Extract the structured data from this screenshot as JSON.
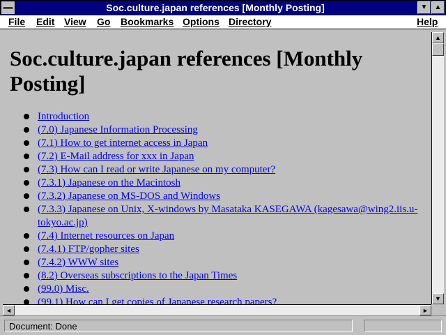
{
  "window": {
    "title": "Soc.culture.japan references [Monthly Posting]",
    "min_glyph": "▼",
    "max_glyph": "▲"
  },
  "menu": [
    {
      "label": "File"
    },
    {
      "label": "Edit"
    },
    {
      "label": "View"
    },
    {
      "label": "Go"
    },
    {
      "label": "Bookmarks"
    },
    {
      "label": "Options"
    },
    {
      "label": "Directory"
    },
    {
      "label": "Help"
    }
  ],
  "document": {
    "heading": "Soc.culture.japan references [Monthly Posting]",
    "links": [
      "Introduction",
      "(7.0) Japanese Information Processing",
      "(7.1) How to get internet access in Japan",
      "(7.2) E-Mail address for xxx in Japan",
      "(7.3) How can I read or write Japanese on my computer?",
      "(7.3.1) Japanese on the Macintosh",
      "(7.3.2) Japanese on MS-DOS and Windows",
      "(7.3.3) Japanese on Unix, X-windows by Masataka KASEGAWA (kagesawa@wing2.iis.u-tokyo.ac.jp)",
      "(7.4) Internet resources on Japan",
      "(7.4.1) FTP/gopher sites",
      "(7.4.2) WWW sites",
      "(8.2) Overseas subscriptions to the Japan Times",
      "(99.0) Misc.",
      "(99.1) How can I get copies of Japanese research papers?"
    ]
  },
  "scrollbars": {
    "up_glyph": "▲",
    "down_glyph": "▼",
    "left_glyph": "◄",
    "right_glyph": "►"
  },
  "status": {
    "text": "Document: Done"
  },
  "colors": {
    "titlebar": "#000080",
    "background": "#c0c0c0",
    "link": "#0000ee"
  }
}
